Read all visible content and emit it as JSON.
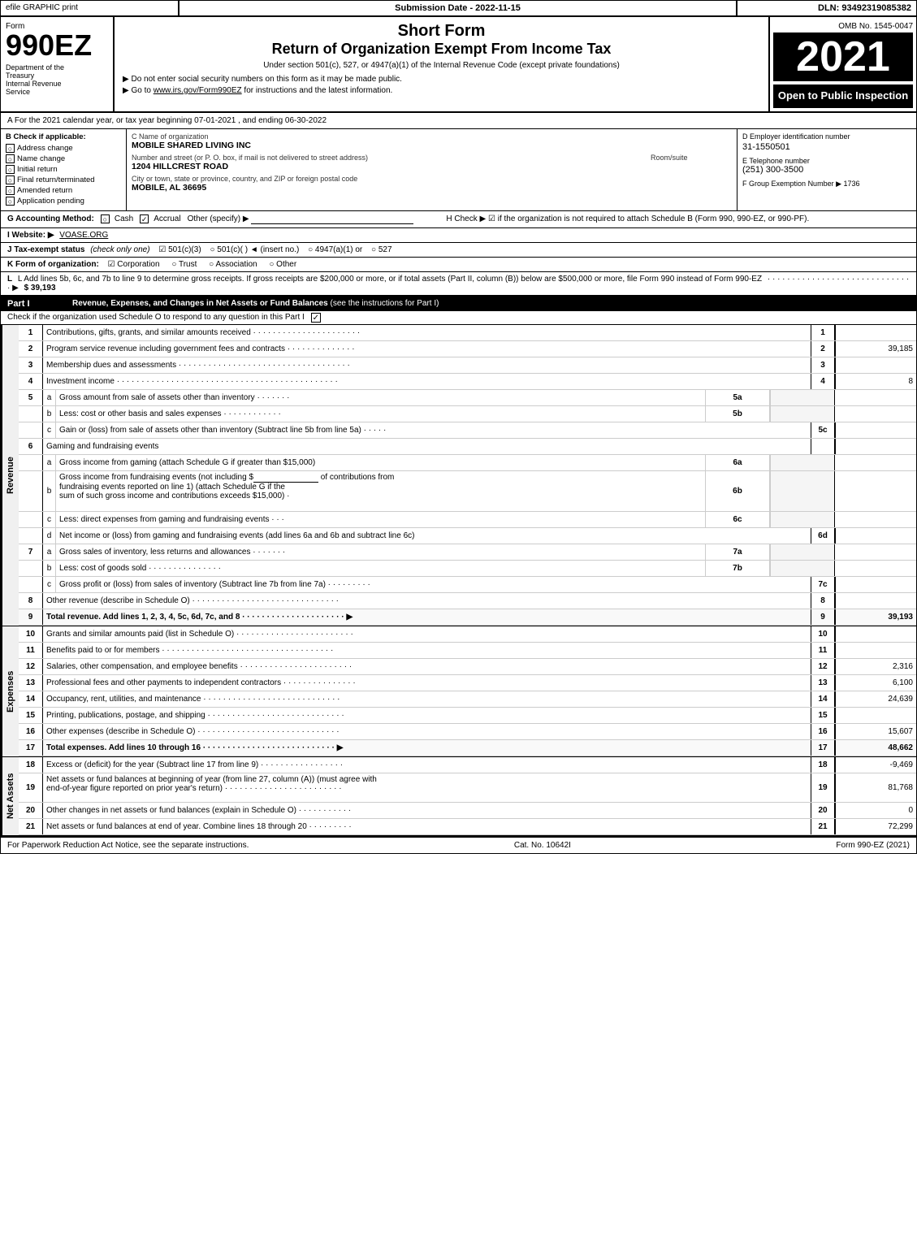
{
  "header": {
    "efile_label": "efile GRAPHIC print",
    "submission_date_label": "Submission Date - 2022-11-15",
    "dln_label": "DLN: 93492319085382",
    "omb_label": "OMB No. 1545-0047",
    "form_number": "990EZ",
    "form_label": "Form",
    "dept_line1": "Department of the",
    "dept_line2": "Treasury",
    "dept_line3": "Internal Revenue",
    "dept_line4": "Service",
    "short_form": "Short Form",
    "return_title": "Return of Organization Exempt From Income Tax",
    "subtitle": "Under section 501(c), 527, or 4947(a)(1) of the Internal Revenue Code (except private foundations)",
    "bullet1": "▶ Do not enter social security numbers on this form as it may be made public.",
    "bullet2": "▶ Go to www.irs.gov/Form990EZ for instructions and the latest information.",
    "year": "2021",
    "open_to_public": "Open to Public Inspection"
  },
  "section_a": {
    "text": "A  For the 2021 calendar year, or tax year beginning 07-01-2021 , and ending 06-30-2022"
  },
  "check_applicable": {
    "label_b": "B  Check if applicable:",
    "address_change": "Address change",
    "name_change": "Name change",
    "initial_return": "Initial return",
    "final_return": "Final return/terminated",
    "amended_return": "Amended return",
    "application_pending": "Application pending"
  },
  "org_info": {
    "name_label": "C Name of organization",
    "name": "MOBILE SHARED LIVING INC",
    "address_label": "Number and street (or P. O. box, if mail is not delivered to street address)",
    "address": "1204 HILLCREST ROAD",
    "room_label": "Room/suite",
    "room": "",
    "city_label": "City or town, state or province, country, and ZIP or foreign postal code",
    "city": "MOBILE, AL  36695"
  },
  "ein": {
    "label": "D Employer identification number",
    "value": "31-1550501",
    "phone_label": "E Telephone number",
    "phone": "(251) 300-3500",
    "group_label": "F Group Exemption",
    "group_number_label": "Number",
    "group_number": "▶ 1736"
  },
  "accounting": {
    "g_label": "G Accounting Method:",
    "cash": "Cash",
    "accrual": "Accrual",
    "other": "Other (specify) ▶",
    "h_label": "H  Check ▶",
    "h_desc": "☑ if the organization is not required to attach Schedule B (Form 990, 990-EZ, or 990-PF)."
  },
  "website": {
    "label": "I  Website: ▶",
    "value": "VOASE.ORG"
  },
  "tax_status": {
    "label": "J Tax-exempt status",
    "check_label": "(check only one)",
    "status_501c3": "☑ 501(c)(3)",
    "status_501c": "○ 501(c)(  )  ◄ (insert no.)",
    "status_4947": "○ 4947(a)(1) or",
    "status_527": "○ 527"
  },
  "form_org": {
    "label": "K Form of organization:",
    "corporation": "☑ Corporation",
    "trust": "○ Trust",
    "association": "○ Association",
    "other": "○ Other"
  },
  "gross_receipts": {
    "label": "L Add lines 5b, 6c, and 7b to line 9 to determine gross receipts. If gross receipts are $200,000 or more, or if total assets (Part II, column (B)) below are $500,000 or more, file Form 990 instead of Form 990-EZ",
    "dots": "· · · · · · · · · · · · · · · · · · · · · · · · · · · · · · ▶",
    "value": "$ 39,193"
  },
  "part1": {
    "label": "Part I",
    "title": "Revenue, Expenses, and Changes in Net Assets or Fund Balances",
    "see_instructions": "(see the instructions for Part I)",
    "schedule_check": "Check if the organization used Schedule O to respond to any question in this Part I",
    "rows": [
      {
        "num": "1",
        "desc": "Contributions, gifts, grants, and similar amounts received · · · · · · · · · · · · · · · · · · · · · ·",
        "line_num": "1",
        "value": ""
      },
      {
        "num": "2",
        "desc": "Program service revenue including government fees and contracts · · · · · · · · · · · · · ·",
        "line_num": "2",
        "value": "39,185"
      },
      {
        "num": "3",
        "desc": "Membership dues and assessments · · · · · · · · · · · · · · · · · · · · · · · · · · · · · · · · · · ·",
        "line_num": "3",
        "value": ""
      },
      {
        "num": "4",
        "desc": "Investment income · · · · · · · · · · · · · · · · · · · · · · · · · · · · · · · · · · · · · · · · · · · · ·",
        "line_num": "4",
        "value": "8"
      },
      {
        "num": "5a",
        "sub": "a",
        "desc": "Gross amount from sale of assets other than inventory · · · · · · ·",
        "box_label": "5a",
        "line_num": "",
        "value": ""
      },
      {
        "num": "5b",
        "sub": "b",
        "desc": "Less: cost or other basis and sales expenses · · · · · · · · · · · ·",
        "box_label": "5b",
        "line_num": "",
        "value": ""
      },
      {
        "num": "5c",
        "sub": "c",
        "desc": "Gain or (loss) from sale of assets other than inventory (Subtract line 5b from line 5a) · · · · ·",
        "line_num": "5c",
        "value": ""
      },
      {
        "num": "6",
        "desc": "Gaming and fundraising events",
        "line_num": "",
        "value": ""
      },
      {
        "num": "6a",
        "sub": "a",
        "desc": "Gross income from gaming (attach Schedule G if greater than $15,000)",
        "box_label": "6a",
        "line_num": "",
        "value": ""
      },
      {
        "num": "6b",
        "sub": "b",
        "desc": "Gross income from fundraising events (not including $_____________ of contributions from fundraising events reported on line 1) (attach Schedule G if the sum of such gross income and contributions exceeds $15,000)   ·",
        "box_label": "6b",
        "line_num": "",
        "value": ""
      },
      {
        "num": "6c",
        "sub": "c",
        "desc": "Less: direct expenses from gaming and fundraising events   ·   ·   ·",
        "box_label": "6c",
        "line_num": "",
        "value": ""
      },
      {
        "num": "6d",
        "sub": "d",
        "desc": "Net income or (loss) from gaming and fundraising events (add lines 6a and 6b and subtract line 6c)",
        "line_num": "6d",
        "value": ""
      },
      {
        "num": "7a",
        "sub": "a",
        "desc": "Gross sales of inventory, less returns and allowances · · · · · · ·",
        "box_label": "7a",
        "line_num": "",
        "value": ""
      },
      {
        "num": "7b",
        "sub": "b",
        "desc": "Less: cost of goods sold   ·   ·   ·   ·   ·   ·   ·   ·   ·   ·   ·   ·   ·   ·   ·",
        "box_label": "7b",
        "line_num": "",
        "value": ""
      },
      {
        "num": "7c",
        "sub": "c",
        "desc": "Gross profit or (loss) from sales of inventory (Subtract line 7b from line 7a)   · · · · · · · · ·",
        "line_num": "7c",
        "value": ""
      },
      {
        "num": "8",
        "desc": "Other revenue (describe in Schedule O) · · · · · · · · · · · · · · · · · · · · · · · · · · · · · ·",
        "line_num": "8",
        "value": ""
      },
      {
        "num": "9",
        "desc": "Total revenue. Add lines 1, 2, 3, 4, 5c, 6d, 7c, and 8 · · · · · · · · · · · · · · · · · · · · · ▶",
        "line_num": "9",
        "value": "39,193",
        "bold": true
      }
    ]
  },
  "expenses": {
    "rows": [
      {
        "num": "10",
        "desc": "Grants and similar amounts paid (list in Schedule O) · · · · · · · · · · · · · · · · · · · · · · · ·",
        "line_num": "10",
        "value": ""
      },
      {
        "num": "11",
        "desc": "Benefits paid to or for members   · · · · · · · · · · · · · · · · · · · · · · · · · · · · · · · · · · ·",
        "line_num": "11",
        "value": ""
      },
      {
        "num": "12",
        "desc": "Salaries, other compensation, and employee benefits · · · · · · · · · · · · · · · · · · · · · · ·",
        "line_num": "12",
        "value": "2,316"
      },
      {
        "num": "13",
        "desc": "Professional fees and other payments to independent contractors · · · · · · · · · · · · · · ·",
        "line_num": "13",
        "value": "6,100"
      },
      {
        "num": "14",
        "desc": "Occupancy, rent, utilities, and maintenance · · · · · · · · · · · · · · · · · · · · · · · · · · · ·",
        "line_num": "14",
        "value": "24,639"
      },
      {
        "num": "15",
        "desc": "Printing, publications, postage, and shipping· · · · · · · · · · · · · · · · · · · · · · · · · · · ·",
        "line_num": "15",
        "value": ""
      },
      {
        "num": "16",
        "desc": "Other expenses (describe in Schedule O)   · · · · · · · · · · · · · · · · · · · · · · · · · · · · ·",
        "line_num": "16",
        "value": "15,607"
      },
      {
        "num": "17",
        "desc": "Total expenses. Add lines 10 through 16   · · · · · · · · · · · · · · · · · · · · · · · · · · · ▶",
        "line_num": "17",
        "value": "48,662",
        "bold": true
      }
    ]
  },
  "net_assets": {
    "rows": [
      {
        "num": "18",
        "desc": "Excess or (deficit) for the year (Subtract line 17 from line 9)   · · · · · · · · · · · · · · · · ·",
        "line_num": "18",
        "value": "-9,469"
      },
      {
        "num": "19",
        "desc": "Net assets or fund balances at beginning of year (from line 27, column (A)) (must agree with end-of-year figure reported on prior year's return) · · · · · · · · · · · · · · · · · · · · · · · ·",
        "line_num": "19",
        "value": "81,768"
      },
      {
        "num": "20",
        "desc": "Other changes in net assets or fund balances (explain in Schedule O) · · · · · · · · · · ·",
        "line_num": "20",
        "value": "0"
      },
      {
        "num": "21",
        "desc": "Net assets or fund balances at end of year. Combine lines 18 through 20 · · · · · · · · ·",
        "line_num": "21",
        "value": "72,299"
      }
    ]
  },
  "footer": {
    "paperwork_label": "For Paperwork Reduction Act Notice, see the separate instructions.",
    "cat_no": "Cat. No. 10642I",
    "form_label": "Form 990-EZ (2021)"
  }
}
